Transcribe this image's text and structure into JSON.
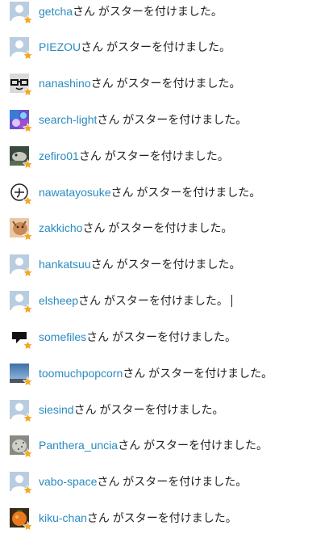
{
  "colors": {
    "link": "#2a8bbf",
    "text": "#222222",
    "star": "#f5a623",
    "default_avatar_bg": "#b9cde0",
    "default_avatar_fg": "#ffffff"
  },
  "suffix": "さん がスターを付けました。",
  "stars": [
    {
      "user": "getcha",
      "avatar": "default-avatar"
    },
    {
      "user": "PIEZOU",
      "avatar": "default-avatar"
    },
    {
      "user": "nanashino",
      "avatar": "glasses-face-avatar"
    },
    {
      "user": "search-light",
      "avatar": "colorful-pattern-avatar"
    },
    {
      "user": "zefiro01",
      "avatar": "photo-animal-avatar"
    },
    {
      "user": "nawatayosuke",
      "avatar": "circled-plus-avatar"
    },
    {
      "user": "zakkicho",
      "avatar": "photo-cat-avatar"
    },
    {
      "user": "hankatsuu",
      "avatar": "default-avatar"
    },
    {
      "user": "elsheep",
      "avatar": "default-avatar"
    },
    {
      "user": "somefiles",
      "avatar": "speech-bubble-avatar"
    },
    {
      "user": "toomuchpopcorn",
      "avatar": "sky-photo-avatar"
    },
    {
      "user": "siesind",
      "avatar": "default-avatar"
    },
    {
      "user": "Panthera_uncia",
      "avatar": "photo-snow-leopard-avatar"
    },
    {
      "user": "vabo-space",
      "avatar": "default-avatar"
    },
    {
      "user": "kiku-chan",
      "avatar": "photo-orange-avatar"
    }
  ]
}
